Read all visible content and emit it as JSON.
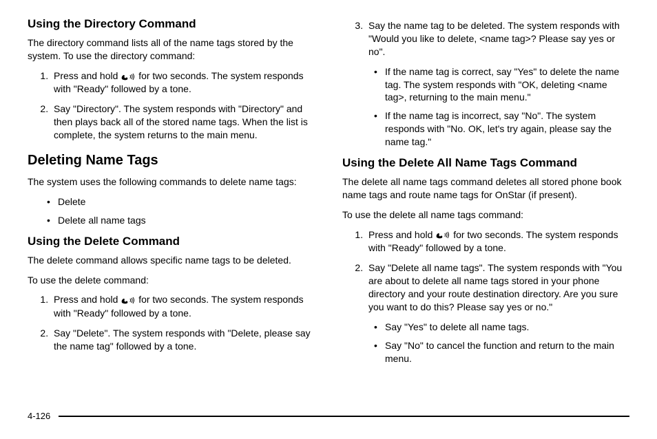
{
  "left": {
    "h3a": "Using the Directory Command",
    "p1": "The directory command lists all of the name tags stored by the system. To use the directory command:",
    "ol1_1a": "Press and hold ",
    "ol1_1b": " for two seconds. The system responds with \"Ready\" followed by a tone.",
    "ol1_2": "Say \"Directory\". The system responds with \"Directory\" and then plays back all of the stored name tags. When the list is complete, the system returns to the main menu.",
    "h2": "Deleting Name Tags",
    "p2": "The system uses the following commands to delete name tags:",
    "ul1_1": "Delete",
    "ul1_2": "Delete all name tags",
    "h3b": "Using the Delete Command",
    "p3": "The delete command allows specific name tags to be deleted.",
    "p4": "To use the delete command:",
    "ol2_1a": "Press and hold ",
    "ol2_1b": " for two seconds. The system responds with \"Ready\" followed by a tone.",
    "ol2_2": "Say \"Delete\". The system responds with \"Delete, please say the name tag\" followed by a tone."
  },
  "right": {
    "ol3_3": "Say the name tag to be deleted. The system responds with \"Would you like to delete, <name tag>? Please say yes or no\".",
    "nested1_1": "If the name tag is correct, say \"Yes\" to delete the name tag. The system responds with \"OK, deleting <name tag>, returning to the main menu.\"",
    "nested1_2": "If the name tag is incorrect, say \"No\". The system responds with \"No. OK, let's try again, please say the name tag.\"",
    "h3c": "Using the Delete All Name Tags Command",
    "p5": "The delete all name tags command deletes all stored phone book name tags and route name tags for OnStar (if present).",
    "p6": "To use the delete all name tags command:",
    "ol4_1a": "Press and hold ",
    "ol4_1b": " for two seconds. The system responds with \"Ready\" followed by a tone.",
    "ol4_2": "Say \"Delete all name tags\". The system responds with \"You are about to delete all name tags stored in your phone directory and your route destination directory. Are you sure you want to do this? Please say yes or no.\"",
    "nested2_1": "Say \"Yes\" to delete all name tags.",
    "nested2_2": "Say \"No\" to cancel the function and return to the main menu."
  },
  "iconGlyph": "📞 🗣",
  "pageNumber": "4-126"
}
